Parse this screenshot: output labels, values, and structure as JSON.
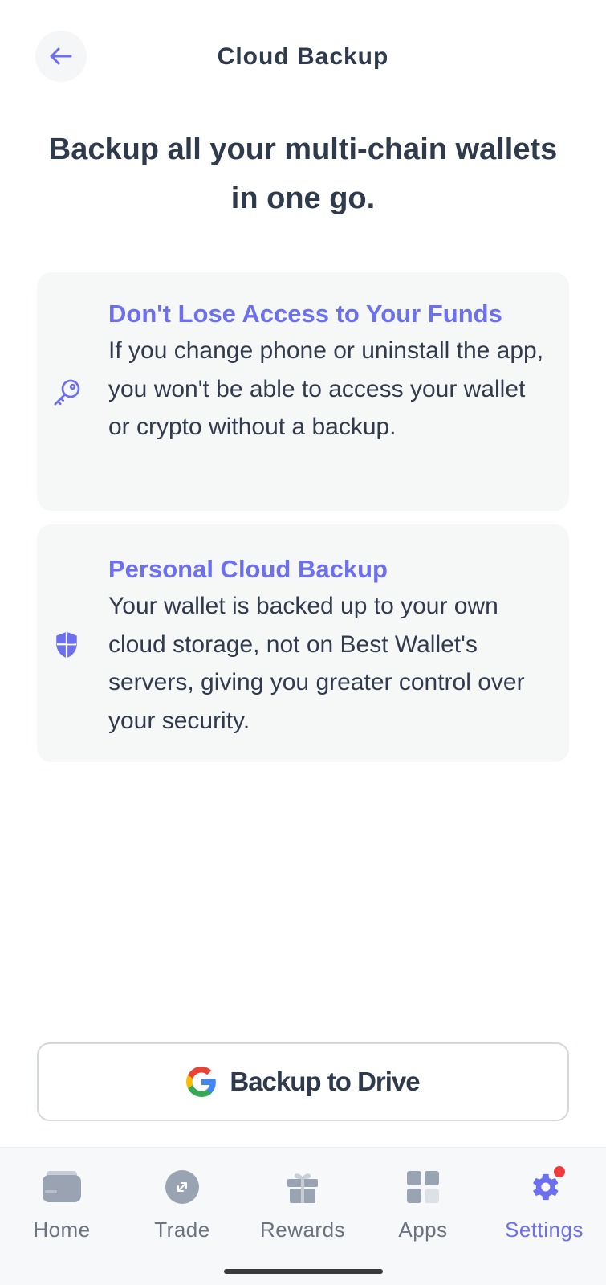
{
  "header": {
    "title": "Cloud Backup",
    "back_icon": "arrow-left-icon"
  },
  "headline": "Backup all your multi-chain wallets in one go.",
  "cards": [
    {
      "icon": "key-icon",
      "title": "Don't Lose Access to Your Funds",
      "body": "If you change phone or uninstall the app, you won't be able to access your wallet or crypto without a backup."
    },
    {
      "icon": "shield-icon",
      "title": "Personal Cloud Backup",
      "body": "Your wallet is backed up to your own cloud storage, not on Best Wallet's servers, giving you greater control over your security."
    }
  ],
  "drive_button": {
    "label": "Backup to Drive",
    "icon": "google-icon"
  },
  "tabbar": {
    "items": [
      {
        "label": "Home",
        "icon": "wallet-card-icon"
      },
      {
        "label": "Trade",
        "icon": "trade-arrows-icon"
      },
      {
        "label": "Rewards",
        "icon": "gift-icon"
      },
      {
        "label": "Apps",
        "icon": "grid-icon"
      },
      {
        "label": "Settings",
        "icon": "gear-icon",
        "active": true,
        "badge": true
      }
    ]
  },
  "colors": {
    "accent": "#6b6ff0",
    "text": "#2f3a4d",
    "card_bg": "#f6f8f8",
    "badge": "#ef3b3b",
    "inactive_icon": "#9aa3b2"
  }
}
